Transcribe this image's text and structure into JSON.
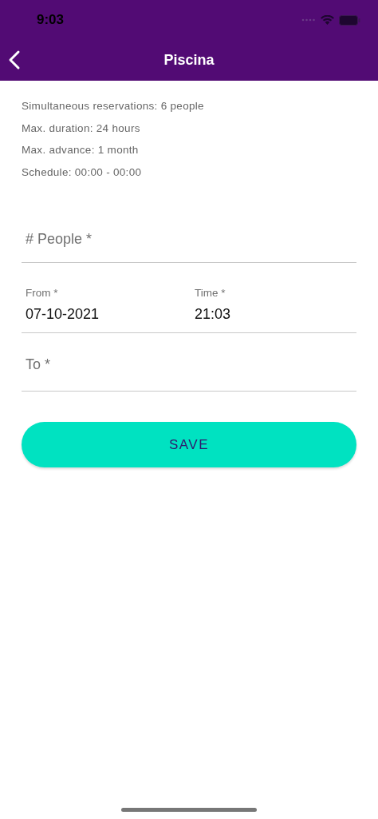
{
  "status_bar": {
    "time": "9:03"
  },
  "nav_bar": {
    "title": "Piscina"
  },
  "info_lines": [
    "Simultaneous reservations: 6 people",
    "Max. duration: 24 hours",
    "Max. advance: 1 month",
    "Schedule: 00:00 - 00:00"
  ],
  "people_field": {
    "placeholder": "# People *"
  },
  "from_field": {
    "label": "From *",
    "value": "07-10-2021"
  },
  "time_field": {
    "label": "Time *",
    "value": "21:03"
  },
  "to_field": {
    "placeholder": "To *"
  },
  "save_button": {
    "label": "SAVE"
  }
}
